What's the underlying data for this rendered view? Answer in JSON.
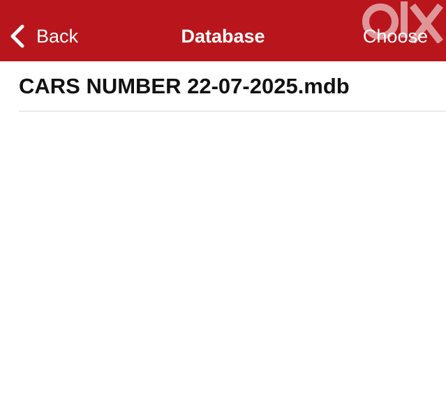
{
  "navbar": {
    "back_label": "Back",
    "title": "Database",
    "choose_label": "Choose",
    "watermark_text": "olx",
    "background_color": "#b8161c",
    "text_color": "#ffffff"
  },
  "files": [
    {
      "name": "CARS NUMBER 22-07-2025.mdb"
    }
  ]
}
